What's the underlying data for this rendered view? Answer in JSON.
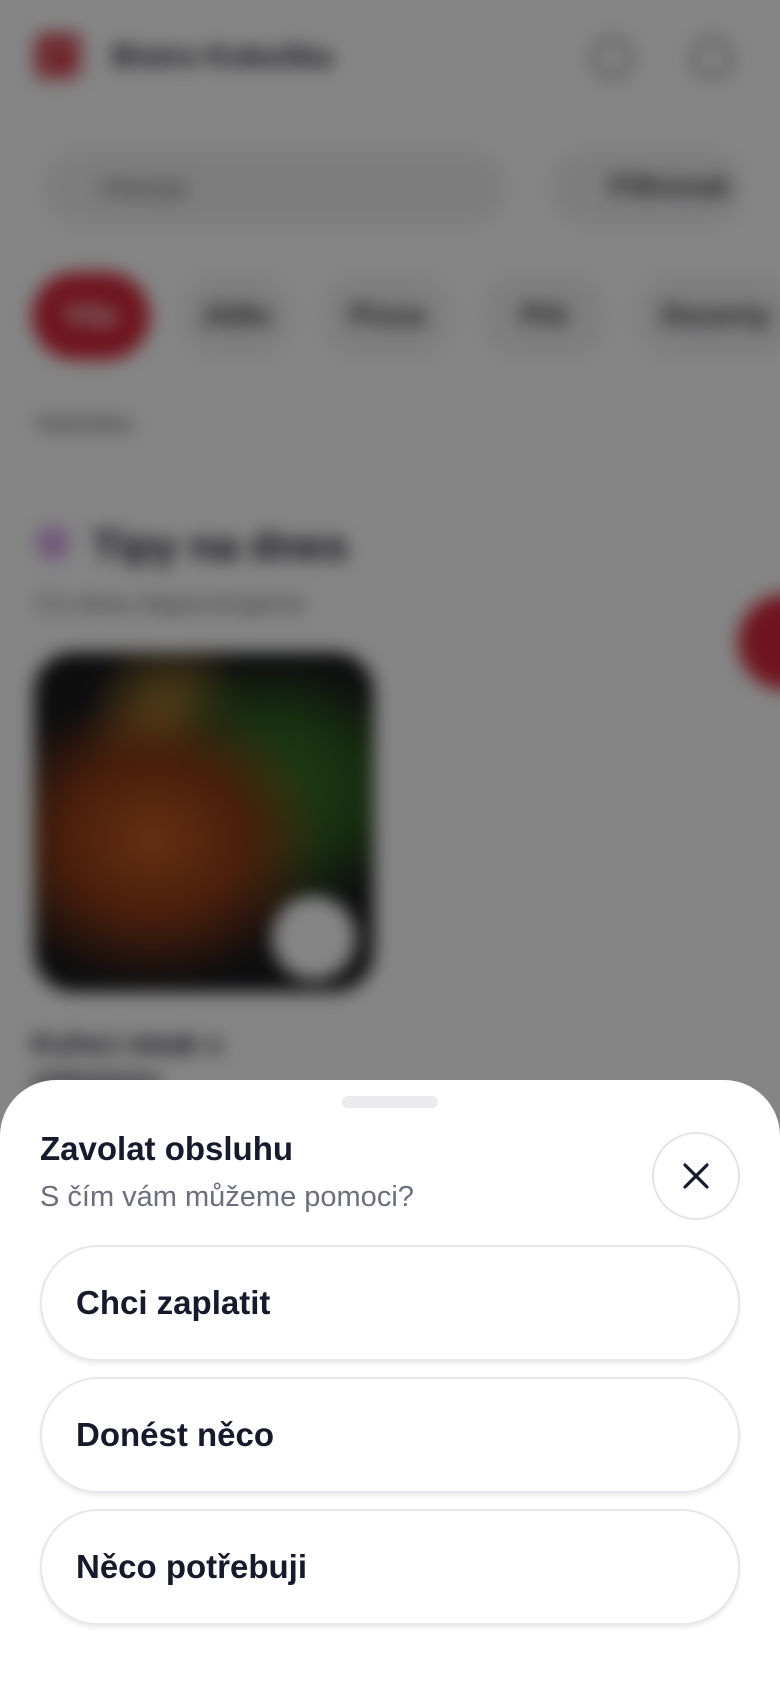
{
  "background": {
    "header": {
      "title": "Bistro Kokoška"
    },
    "search": {
      "placeholder": "Hledat"
    },
    "filter_label": "Filtrovat",
    "categories": [
      "Vše",
      "Jídlo",
      "Pizza",
      "Pití",
      "Dezerty"
    ],
    "section_label": "Nabídka",
    "tips": {
      "title": "Tipy na dnes",
      "subtitle": "Co dnes doporučujeme"
    },
    "food_item": {
      "name": "Kuřecí steak s",
      "name_line2": "zeleninou"
    }
  },
  "sheet": {
    "title": "Zavolat obsluhu",
    "subtitle": "S čím vám můžeme pomoci?",
    "options": [
      {
        "label": "Chci zaplatit"
      },
      {
        "label": "Donést něco"
      },
      {
        "label": "Něco potřebuji"
      }
    ]
  },
  "colors": {
    "accent": "#d5283a",
    "text_primary": "#161a2b",
    "text_secondary": "#6b6f7b"
  }
}
